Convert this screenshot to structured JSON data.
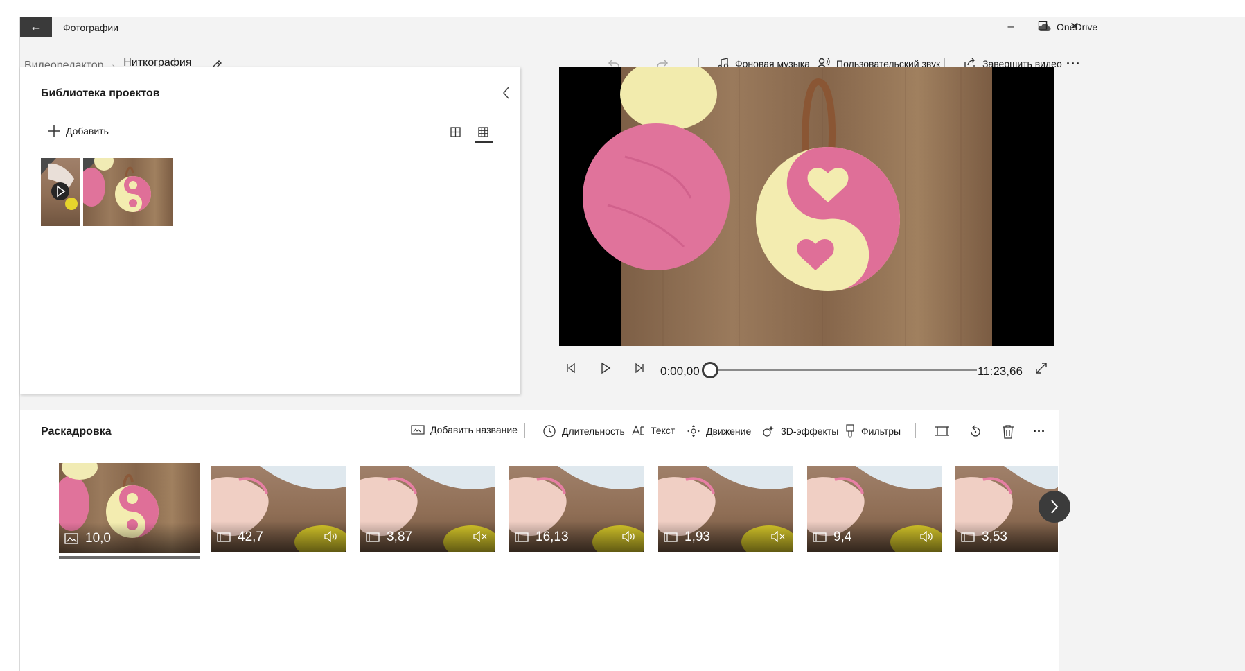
{
  "app": {
    "title": "Фотографии",
    "back_glyph": "←",
    "onedrive_label": "OneDrive"
  },
  "window_controls": {
    "minimize": "–",
    "maximize": "❐",
    "close": "✕"
  },
  "breadcrumb": {
    "root": "Видеоредактор",
    "separator": "›",
    "current": "Ниткография"
  },
  "toolbar": {
    "undo_icon": "undo-icon",
    "redo_icon": "redo-icon",
    "background_music": "Фоновая музыка",
    "custom_audio": "Пользовательский звук",
    "finish_video": "Завершить видео",
    "more": "···"
  },
  "library": {
    "title": "Библиотека проектов",
    "add_label": "Добавить",
    "views": [
      "large-grid-icon",
      "small-grid-icon"
    ],
    "active_view": 1
  },
  "player": {
    "current_time": "0:00,00",
    "total_time": "11:23,66",
    "progress": 0.0
  },
  "storyboard": {
    "title": "Раскадровка",
    "add_title": "Добавить название",
    "duration": "Длительность",
    "text": "Текст",
    "motion": "Движение",
    "effects_3d": "3D-эффекты",
    "filters": "Фильтры",
    "more": "···",
    "clips": [
      {
        "duration": "10,0",
        "type": "image",
        "audio": "none",
        "selected": true
      },
      {
        "duration": "42,7",
        "type": "video",
        "audio": "on"
      },
      {
        "duration": "3,87",
        "type": "video",
        "audio": "muted"
      },
      {
        "duration": "16,13",
        "type": "video",
        "audio": "on"
      },
      {
        "duration": "1,93",
        "type": "video",
        "audio": "muted"
      },
      {
        "duration": "9,4",
        "type": "video",
        "audio": "on"
      },
      {
        "duration": "3,53",
        "type": "video",
        "audio": "none"
      }
    ]
  },
  "colors": {
    "accent_dark": "#3a3a3a",
    "panel_bg": "#f3f3f3",
    "yarn_pink": "#e0739b",
    "yarn_yellow": "#f3ecb0",
    "wood": "#8a6a4e"
  }
}
